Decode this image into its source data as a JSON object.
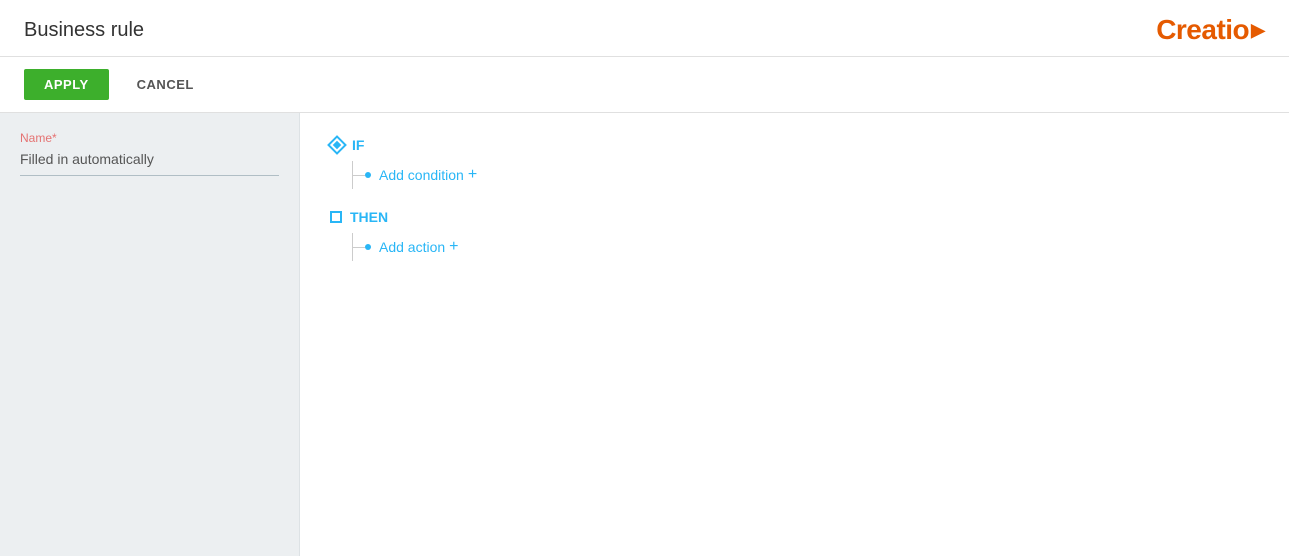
{
  "header": {
    "title": "Business rule",
    "logo_text": "Creatio",
    "logo_arrow": "▶"
  },
  "toolbar": {
    "apply_label": "APPLY",
    "cancel_label": "CANCEL"
  },
  "left_panel": {
    "field_label": "Name",
    "field_required": "*",
    "field_value": "Filled in automatically"
  },
  "rule_tree": {
    "if_keyword": "IF",
    "add_condition_label": "Add condition",
    "add_condition_plus": "+",
    "then_keyword": "THEN",
    "add_action_label": "Add action",
    "add_action_plus": "+"
  }
}
